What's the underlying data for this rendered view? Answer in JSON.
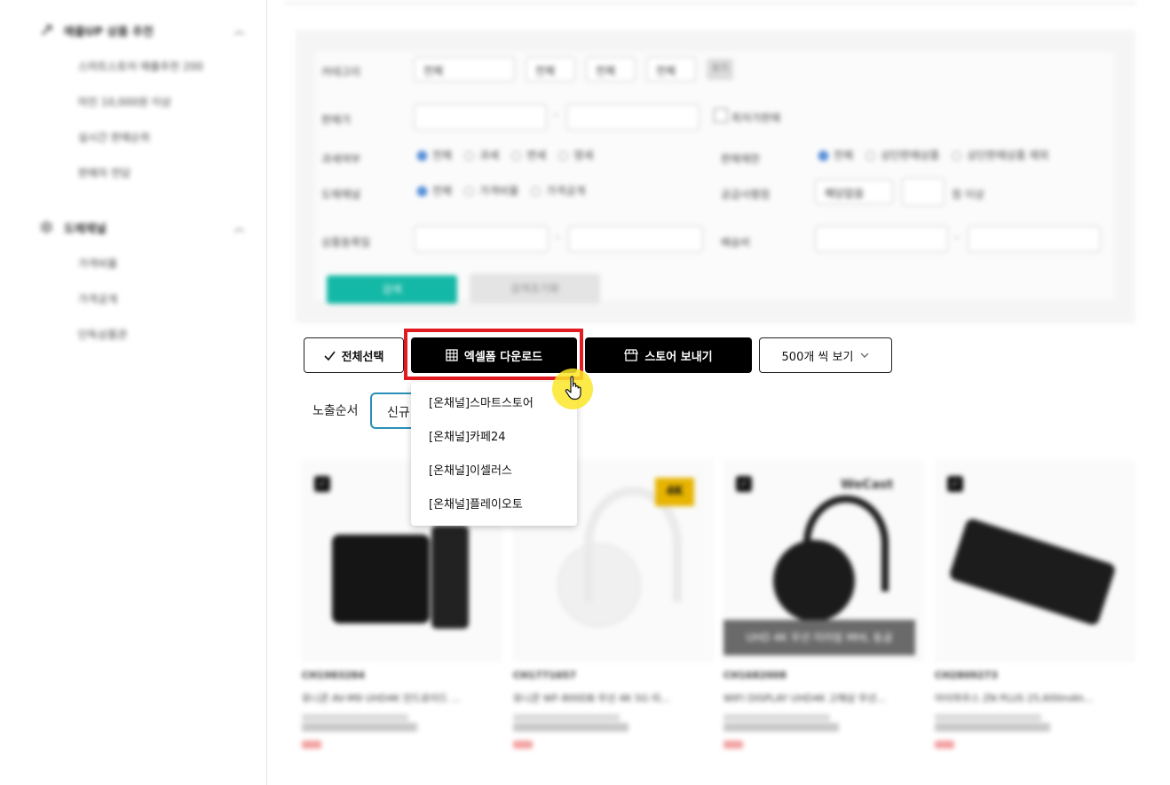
{
  "sidebar": {
    "sections": [
      {
        "title": "매출UP 상품 추천",
        "icon": "trend-icon",
        "items": [
          "스마트스토어 매출추천 200",
          "마진 10,000원 이상",
          "실시간 판매순위",
          "판매자 전담"
        ]
      },
      {
        "title": "도매채널",
        "icon": "star-icon",
        "items": [
          "가격비율",
          "가격공개",
          "단독상품관"
        ]
      }
    ]
  },
  "filters": {
    "category_label": "카테고리",
    "category_selects": [
      "전체",
      "전체",
      "전체",
      "전체"
    ],
    "category_reset": "초기",
    "price_label": "판매가",
    "price_checkbox": "최저가판매",
    "tax_label": "과세여부",
    "tax_options": [
      "전체",
      "과세",
      "면세",
      "영세"
    ],
    "sales_limit_label": "판매제한",
    "sales_limit_options": [
      "전체",
      "상단판매상품",
      "상단판매상품 제외"
    ],
    "wholesale_label": "도매채널",
    "wholesale_options": [
      "전체",
      "가격비율",
      "가격공개"
    ],
    "supply_label": "공급사평점",
    "supply_select": "해당없음",
    "supply_suffix": "점 이상",
    "reg_date_label": "상품등록일",
    "shipping_label": "배송비",
    "search_button": "검색",
    "reset_button": "검색초기화"
  },
  "actions": {
    "select_all": "전체선택",
    "excel_download": "엑셀폼 다운로드",
    "send_store": "스토어 보내기",
    "page_size": "500개 씩 보기"
  },
  "sort": {
    "label": "노출순서",
    "value": "신규"
  },
  "dropdown": {
    "items": [
      "[온채널]스마트스토어",
      "[온채널]카페24",
      "[온채널]이셀러스",
      "[온채널]플레이오토"
    ]
  },
  "products": [
    {
      "code": "CH1983284",
      "name": "유니콘 AV-M9 UHD4K 안드로이드 ..."
    },
    {
      "code": "CH1771657",
      "name": "유니콘 WF-800DB 무선 4K 5G 미..."
    },
    {
      "code": "CH1682008",
      "name": "WIFI DISPLAY UHD4K 고해상 무선..."
    },
    {
      "code": "CH2809273",
      "name": "아이하우스 ZN PLUS 25,600mAh..."
    }
  ],
  "product_badges": {
    "badge_4k": "4K",
    "wecast": "WeCast",
    "wecast_caption": "UHD 4K 무선 미러링 MHL 동글"
  }
}
